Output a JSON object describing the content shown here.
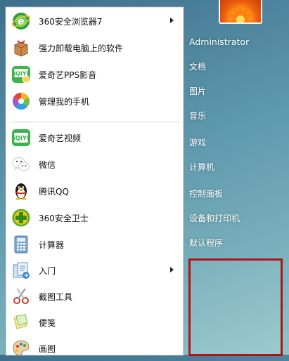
{
  "programs": [
    {
      "label": "360安全浏览器7",
      "icon": "ie-browser-icon",
      "has_submenu": true
    },
    {
      "label": "强力卸载电脑上的软件",
      "icon": "uninstall-box-icon",
      "has_submenu": false
    },
    {
      "label": "爱奇艺PPS影音",
      "icon": "iqiyi-pps-icon",
      "has_submenu": false
    },
    {
      "label": "管理我的手机",
      "icon": "phone-manager-icon",
      "has_submenu": false
    },
    {
      "label": "爱奇艺视频",
      "icon": "iqiyi-icon",
      "has_submenu": false
    },
    {
      "label": "微信",
      "icon": "wechat-icon",
      "has_submenu": false
    },
    {
      "label": "腾讯QQ",
      "icon": "qq-penguin-icon",
      "has_submenu": false
    },
    {
      "label": "360安全卫士",
      "icon": "360-guard-icon",
      "has_submenu": false
    },
    {
      "label": "计算器",
      "icon": "calculator-icon",
      "has_submenu": false
    },
    {
      "label": "入门",
      "icon": "getting-started-icon",
      "has_submenu": true
    },
    {
      "label": "截图工具",
      "icon": "snipping-tool-icon",
      "has_submenu": false
    },
    {
      "label": "便笺",
      "icon": "sticky-notes-icon",
      "has_submenu": false
    },
    {
      "label": "画图",
      "icon": "paint-palette-icon",
      "has_submenu": false
    }
  ],
  "right_items": [
    {
      "label": "Administrator"
    },
    {
      "label": "文档"
    },
    {
      "label": "图片"
    },
    {
      "label": "音乐"
    },
    {
      "label": "游戏"
    },
    {
      "label": "计算机"
    },
    {
      "label": "控制面板"
    },
    {
      "label": "设备和打印机"
    },
    {
      "label": "默认程序"
    }
  ],
  "colors": {
    "highlight_border": "#b01414",
    "menu_background": "#ffffff",
    "right_pane_text": "#ffffff"
  }
}
